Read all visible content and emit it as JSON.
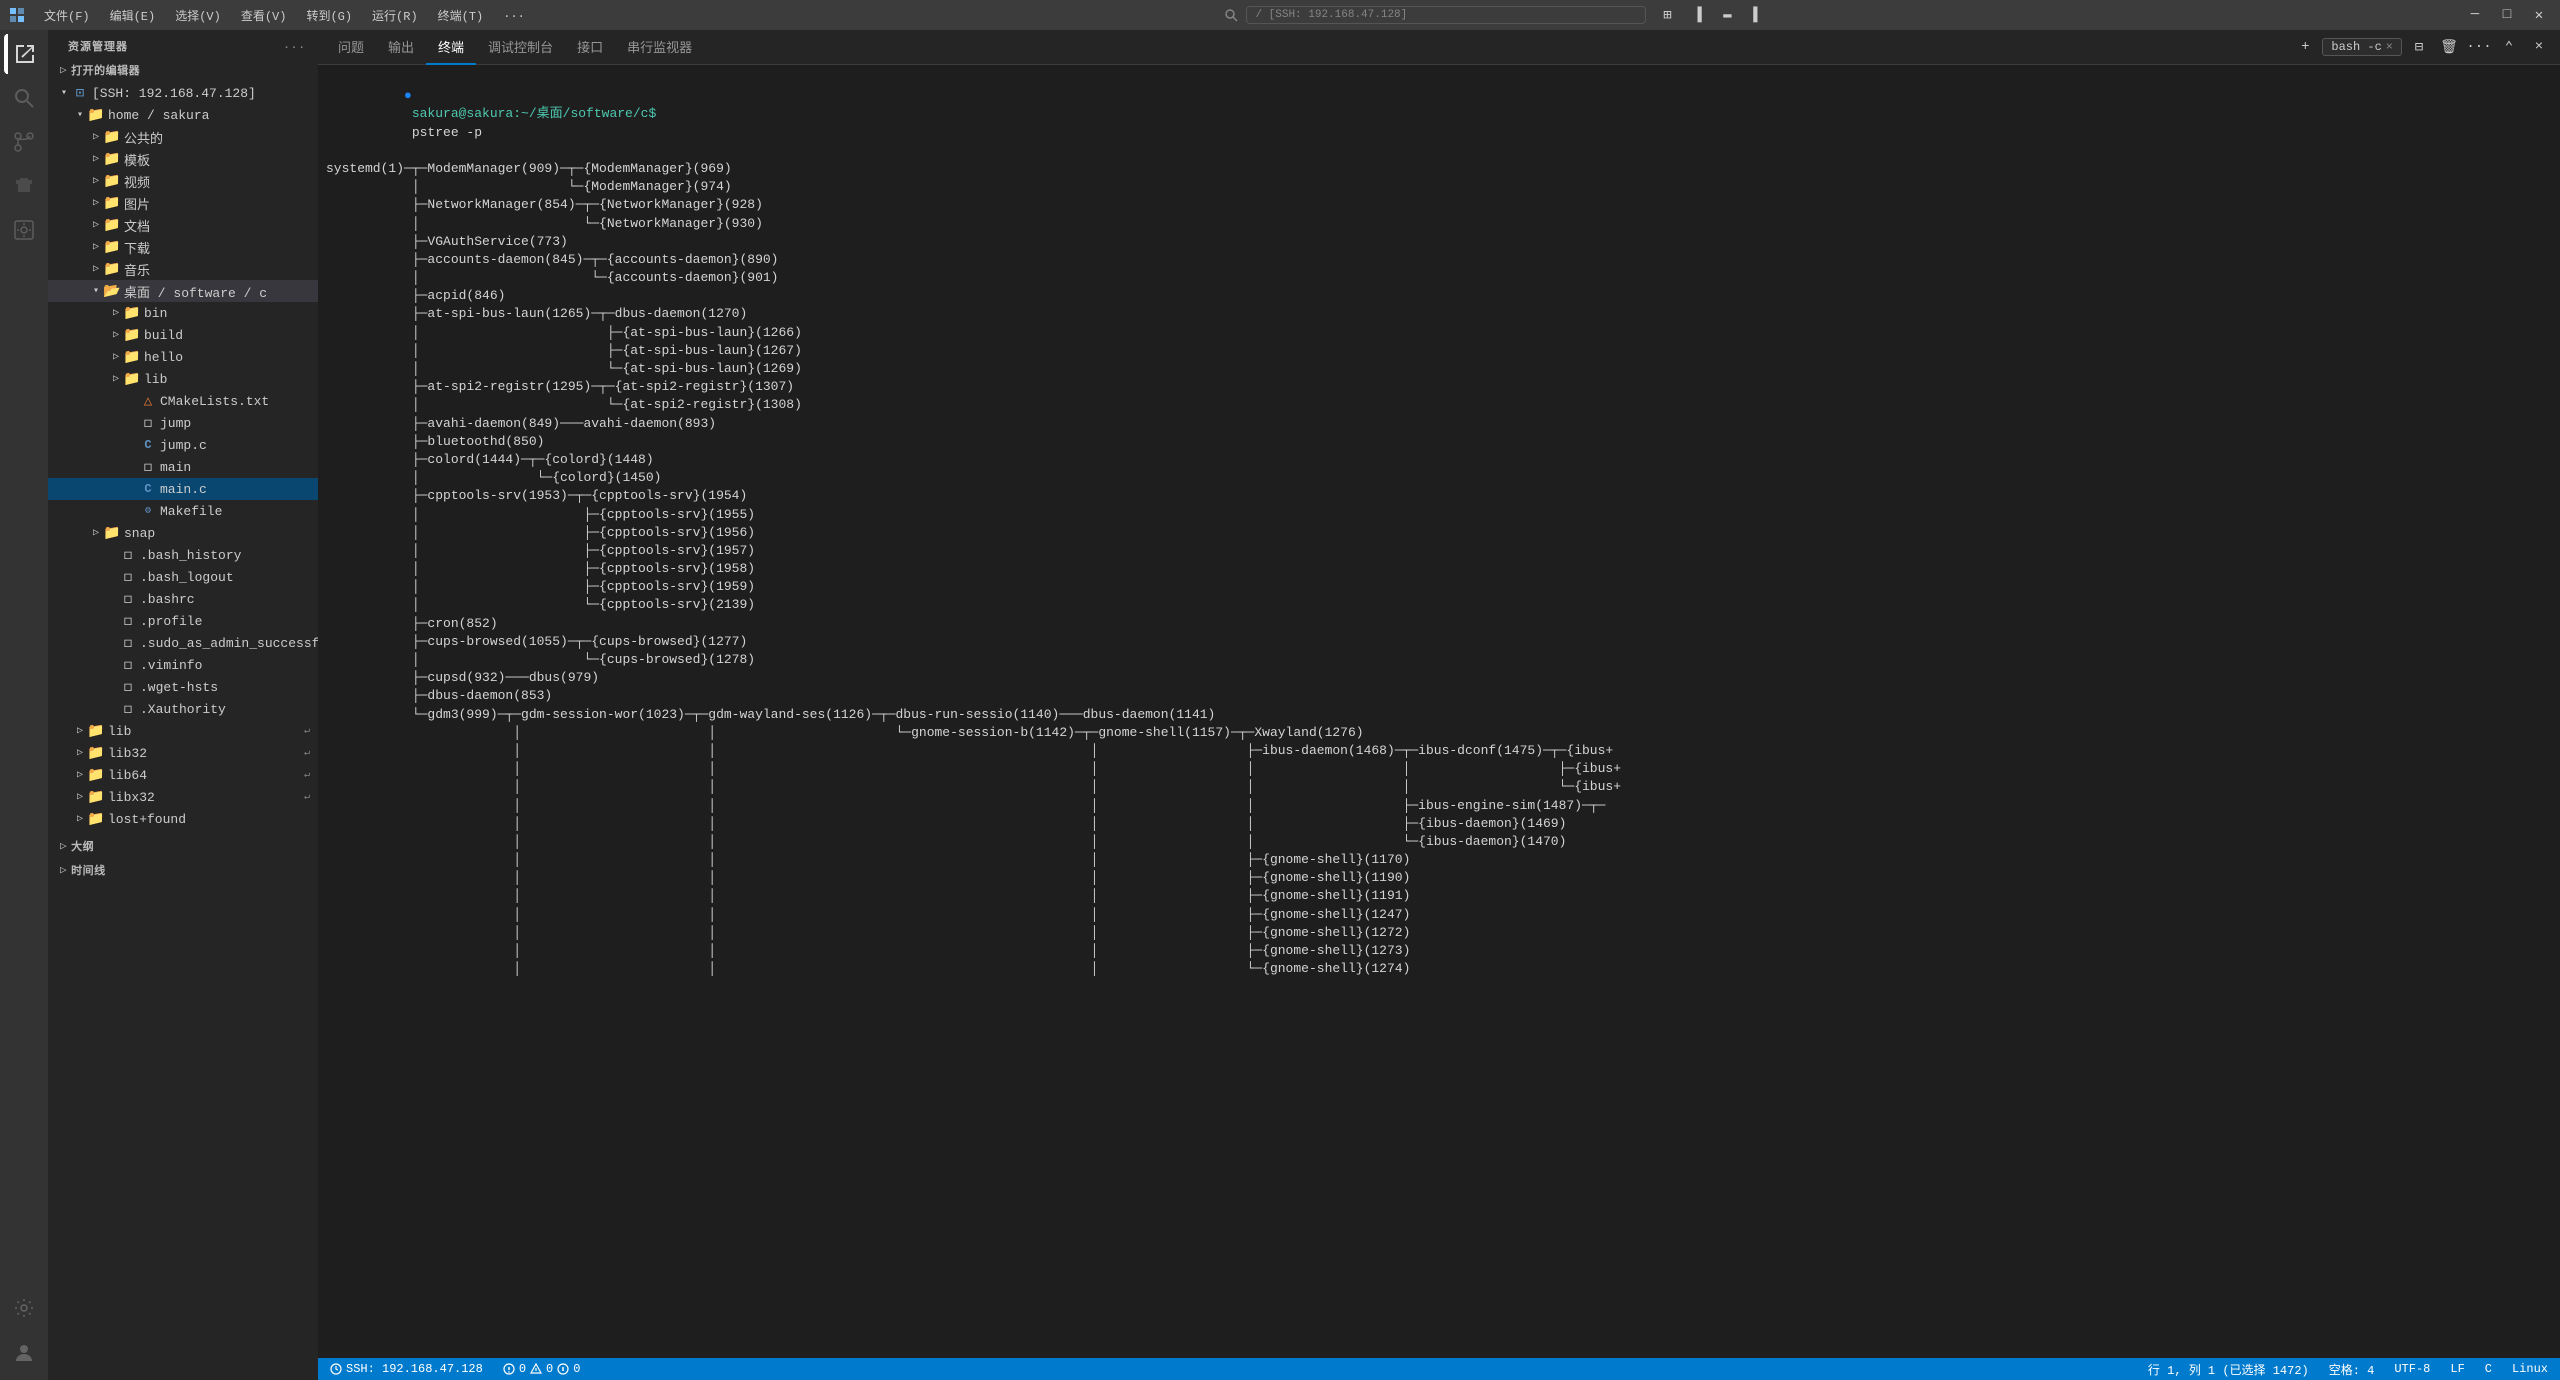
{
  "titlebar": {
    "icon": "◈",
    "menus": [
      "文件(F)",
      "编辑(E)",
      "选择(V)",
      "查看(V)",
      "转到(G)",
      "运行(R)",
      "终端(T)",
      "..."
    ],
    "search_placeholder": "/ [SSH: 192.168.47.128]",
    "window_controls": [
      "minimize",
      "maximize",
      "restore",
      "close"
    ]
  },
  "sidebar": {
    "title": "资源管理器",
    "more_icon": "...",
    "open_editors_label": "打开的编辑器",
    "ssh_label": "[SSH: 192.168.47.128]",
    "home_sakura": "home / sakura",
    "items": [
      {
        "label": "公共的",
        "type": "folder",
        "indent": 2,
        "expanded": false
      },
      {
        "label": "模板",
        "type": "folder",
        "indent": 2,
        "expanded": false
      },
      {
        "label": "视频",
        "type": "folder",
        "indent": 2,
        "expanded": false
      },
      {
        "label": "图片",
        "type": "folder",
        "indent": 2,
        "expanded": false
      },
      {
        "label": "文档",
        "type": "folder",
        "indent": 2,
        "expanded": false
      },
      {
        "label": "下载",
        "type": "folder",
        "indent": 2,
        "expanded": false
      },
      {
        "label": "音乐",
        "type": "folder",
        "indent": 2,
        "expanded": false
      },
      {
        "label": "桌面 / software / c",
        "type": "folder-open",
        "indent": 2,
        "expanded": true
      },
      {
        "label": "bin",
        "type": "folder",
        "indent": 3,
        "expanded": false
      },
      {
        "label": "build",
        "type": "folder",
        "indent": 3,
        "expanded": false
      },
      {
        "label": "hello",
        "type": "folder",
        "indent": 3,
        "expanded": false
      },
      {
        "label": "lib",
        "type": "folder",
        "indent": 3,
        "expanded": false
      },
      {
        "label": "CMakeLists.txt",
        "type": "cmake",
        "indent": 3
      },
      {
        "label": "jump",
        "type": "file",
        "indent": 3
      },
      {
        "label": "jump.c",
        "type": "c-file",
        "indent": 3
      },
      {
        "label": "main",
        "type": "file",
        "indent": 3
      },
      {
        "label": "main.c",
        "type": "c-file",
        "indent": 3,
        "active": true
      },
      {
        "label": "Makefile",
        "type": "makefile",
        "indent": 3
      },
      {
        "label": "snap",
        "type": "folder",
        "indent": 2,
        "expanded": false
      },
      {
        "label": ".bash_history",
        "type": "file",
        "indent": 2
      },
      {
        "label": ".bash_logout",
        "type": "file",
        "indent": 2
      },
      {
        "label": ".bashrc",
        "type": "file",
        "indent": 2
      },
      {
        "label": ".profile",
        "type": "file",
        "indent": 2
      },
      {
        "label": ".sudo_as_admin_successful",
        "type": "file",
        "indent": 2
      },
      {
        "label": ".viminfo",
        "type": "file",
        "indent": 2
      },
      {
        "label": ".wget-hsts",
        "type": "file",
        "indent": 2
      },
      {
        "label": ".Xauthority",
        "type": "file",
        "indent": 2
      },
      {
        "label": "lib",
        "type": "folder",
        "indent": 1,
        "expanded": false,
        "has_arrow": true
      },
      {
        "label": "lib32",
        "type": "folder",
        "indent": 1,
        "expanded": false,
        "has_arrow": true
      },
      {
        "label": "lib64",
        "type": "folder",
        "indent": 1,
        "expanded": false,
        "has_arrow": true
      },
      {
        "label": "libx32",
        "type": "folder",
        "indent": 1,
        "expanded": false,
        "has_arrow": true
      },
      {
        "label": "lost+found",
        "type": "folder",
        "indent": 1,
        "expanded": false
      }
    ],
    "sections": [
      {
        "label": "大纲",
        "expanded": false
      },
      {
        "label": "时间线",
        "expanded": false
      }
    ]
  },
  "panel": {
    "tabs": [
      "问题",
      "输出",
      "终端",
      "调试控制台",
      "接口",
      "串行监视器"
    ],
    "active_tab": "终端",
    "terminal_tabs": [
      {
        "label": "bash -c",
        "active": true
      }
    ],
    "new_terminal_label": "+",
    "split_label": "⧉",
    "trash_label": "🗑",
    "more_label": "...",
    "maximize_label": "⌃",
    "close_label": "×"
  },
  "terminal": {
    "prompt_user": "sakura@sakura",
    "prompt_path": ":~/桌面/software/c$",
    "command": "pstree -p",
    "output_lines": [
      "systemd(1)─┬─ModemManager(909)─┬─{ModemManager}(969)",
      "            │                   └─{ModemManager}(974)",
      "            ├─NetworkManager(854)─┬─{NetworkManager}(928)",
      "            │                     └─{NetworkManager}(930)",
      "            ├─VGAuthService(773)",
      "            ├─accounts-daemon(845)─┬─{accounts-daemon}(890)",
      "            │                      └─{accounts-daemon}(901)",
      "            ├─acpid(846)",
      "            ├─at-spi-bus-laun(1265)─┬─dbus-daemon(1270)",
      "            │                        ├─{at-spi-bus-laun}(1266)",
      "            │                        ├─{at-spi-bus-laun}(1267)",
      "            │                        └─{at-spi-bus-laun}(1269)",
      "            ├─at-spi2-registr(1295)─┬─{at-spi2-registr}(1307)",
      "            │                        └─{at-spi2-registr}(1308)",
      "            ├─avahi-daemon(849)───avahi-daemon(893)",
      "            ├─bluetoothd(850)",
      "            ├─colord(1444)─┬─{colord}(1448)",
      "            │               └─{colord}(1450)",
      "            ├─cpptools-srv(1953)─┬─{cpptools-srv}(1954)",
      "            │                     ├─{cpptools-srv}(1955)",
      "            │                     ├─{cpptools-srv}(1956)",
      "            │                     ├─{cpptools-srv}(1957)",
      "            │                     ├─{cpptools-srv}(1958)",
      "            │                     ├─{cpptools-srv}(1959)",
      "            │                     └─{cpptools-srv}(2139)",
      "            ├─cron(852)",
      "            ├─cups-browsed(1055)─┬─{cups-browsed}(1277)",
      "            │                     └─{cups-browsed}(1278)",
      "            ├─cupsd(932)───dbus(979)",
      "            ├─dbus-daemon(853)",
      "            └─gdm3(999)─┬─gdm-session-wor(1023)─┬─gdm-wayland-ses(1126)─┬─dbus-run-sessio(1140)───dbus-daemon(1141)",
      "                         │                         │                        └─gnome-session-b(1142)─┬─gnome-shell(1157)─┬─Xwayland(1276)",
      "                         │                         │                                                 │                   ├─ibus-daemon(1468)─┬─ibus-dconf(1475)─┬─{ibus+",
      "                         │                         │                                                 │                   │                    │                   ├─{ibus+",
      "                         │                         │                                                 │                   │                    │                   └─{ibus+",
      "                         │                         │                                                 │                   │                    ├─ibus-engine-sim(1487)─┬─",
      "                         │                         │                                                 │                   │                    ├─{ibus-daemon}(1469)",
      "                         │                         │                                                 │                   │                    └─{ibus-daemon}(1470)",
      "                         │                         │                                                 │                   ├─{gnome-shell}(1170)",
      "                         │                         │                                                 │                   ├─{gnome-shell}(1190)",
      "                         │                         │                                                 │                   ├─{gnome-shell}(1191)",
      "                         │                         │                                                 │                   ├─{gnome-shell}(1247)",
      "                         │                         │                                                 │                   ├─{gnome-shell}(1272)",
      "                         │                         │                                                 │                   ├─{gnome-shell}(1273)",
      "                         │                         │                                                 │                   └─{gnome-shell}(1274)"
    ]
  },
  "status_bar": {
    "ssh_label": "SSH: 192.168.47.128",
    "errors": "0",
    "warnings": "0",
    "info": "0",
    "cursor_position": "行 1, 列 1 (已选择 1472)",
    "spaces": "空格: 4",
    "encoding": "UTF-8",
    "line_ending": "LF",
    "language": "C",
    "os": "Linux"
  }
}
